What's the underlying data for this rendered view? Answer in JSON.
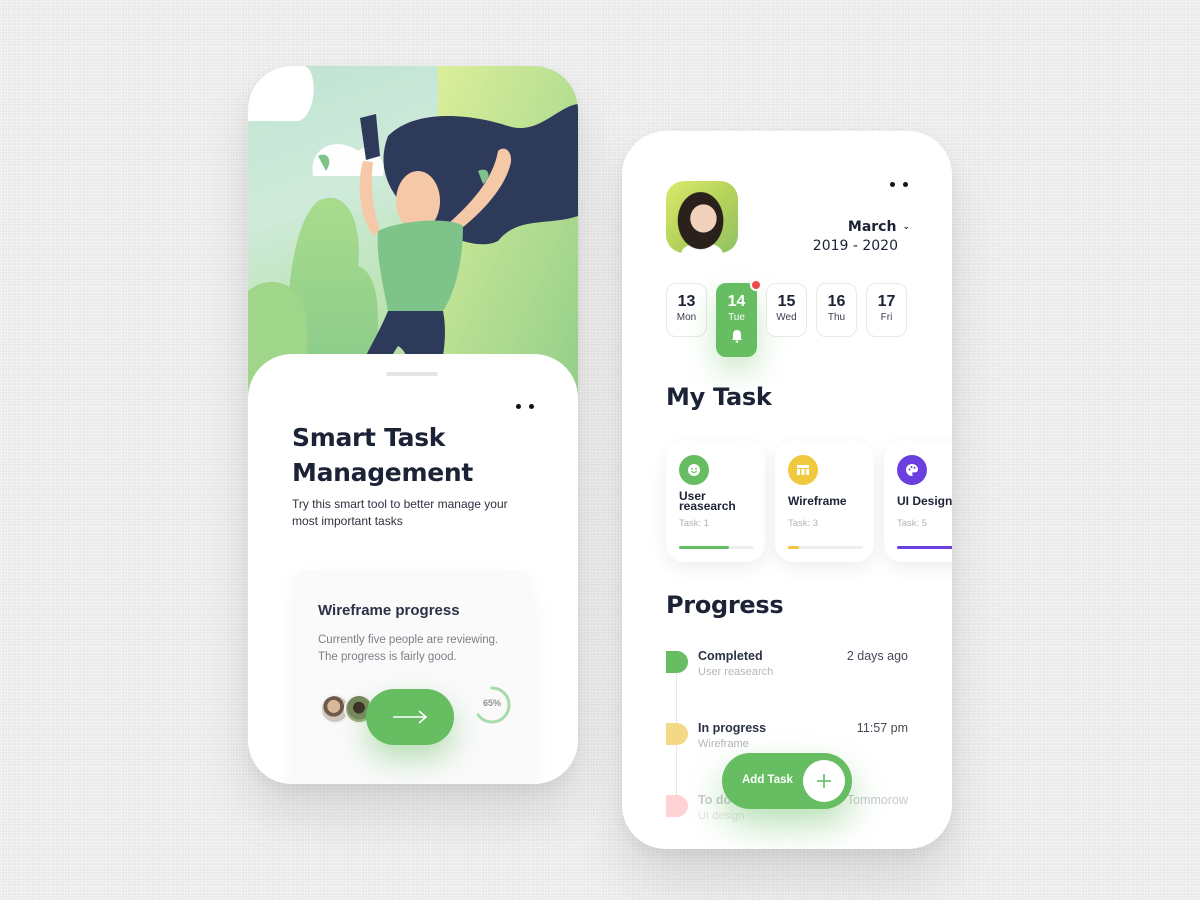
{
  "onboarding": {
    "title": "Smart Task Management",
    "subtitle": "Try this smart tool to better manage your most important tasks",
    "menu_icon": "more-dots-icon",
    "card": {
      "title": "Wireframe progress",
      "description": "Currently five people are reviewing. The progress is fairly good.",
      "reviewers": [
        "reviewer-1",
        "reviewer-2",
        "reviewer-3"
      ],
      "progress_percent": 65,
      "progress_label": "65%",
      "next_icon": "arrow-right-icon"
    }
  },
  "dashboard": {
    "menu_icon": "more-dots-icon",
    "month": "March",
    "month_icon": "chevron-down-icon",
    "year_range": "2019 - 2020",
    "days": [
      {
        "num": "13",
        "name": "Mon",
        "active": false
      },
      {
        "num": "14",
        "name": "Tue",
        "active": true,
        "notification": true
      },
      {
        "num": "15",
        "name": "Wed",
        "active": false
      },
      {
        "num": "16",
        "name": "Thu",
        "active": false
      },
      {
        "num": "17",
        "name": "Fri",
        "active": false
      }
    ],
    "my_task_title": "My Task",
    "tasks": [
      {
        "name": "User reasearch",
        "count": "Task: 1",
        "progress": 0.67,
        "color": "#66bd62",
        "icon": "smile-icon"
      },
      {
        "name": "Wireframe",
        "count": "Task: 3",
        "progress": 0.15,
        "color": "#f0c93e",
        "icon": "table-icon"
      },
      {
        "name": "UI Design",
        "count": "Task: 5",
        "progress": 0.82,
        "color": "#6a3fe0",
        "icon": "palette-icon"
      }
    ],
    "progress_title": "Progress",
    "timeline": [
      {
        "status": "Completed",
        "task": "User reasearch",
        "time": "2 days ago",
        "color": "#66bd62"
      },
      {
        "status": "In progress",
        "task": "Wireframe",
        "time": "11:57 pm",
        "color": "#f3d886"
      },
      {
        "status": "To do",
        "task": "UI design",
        "time": "Tommorow",
        "color": "#ffd3d3"
      }
    ],
    "add_task_label": "Add Task",
    "add_icon": "plus-icon"
  },
  "colors": {
    "accent": "#66bd62",
    "notification": "#f0484c",
    "text_dark": "#1d2336"
  }
}
